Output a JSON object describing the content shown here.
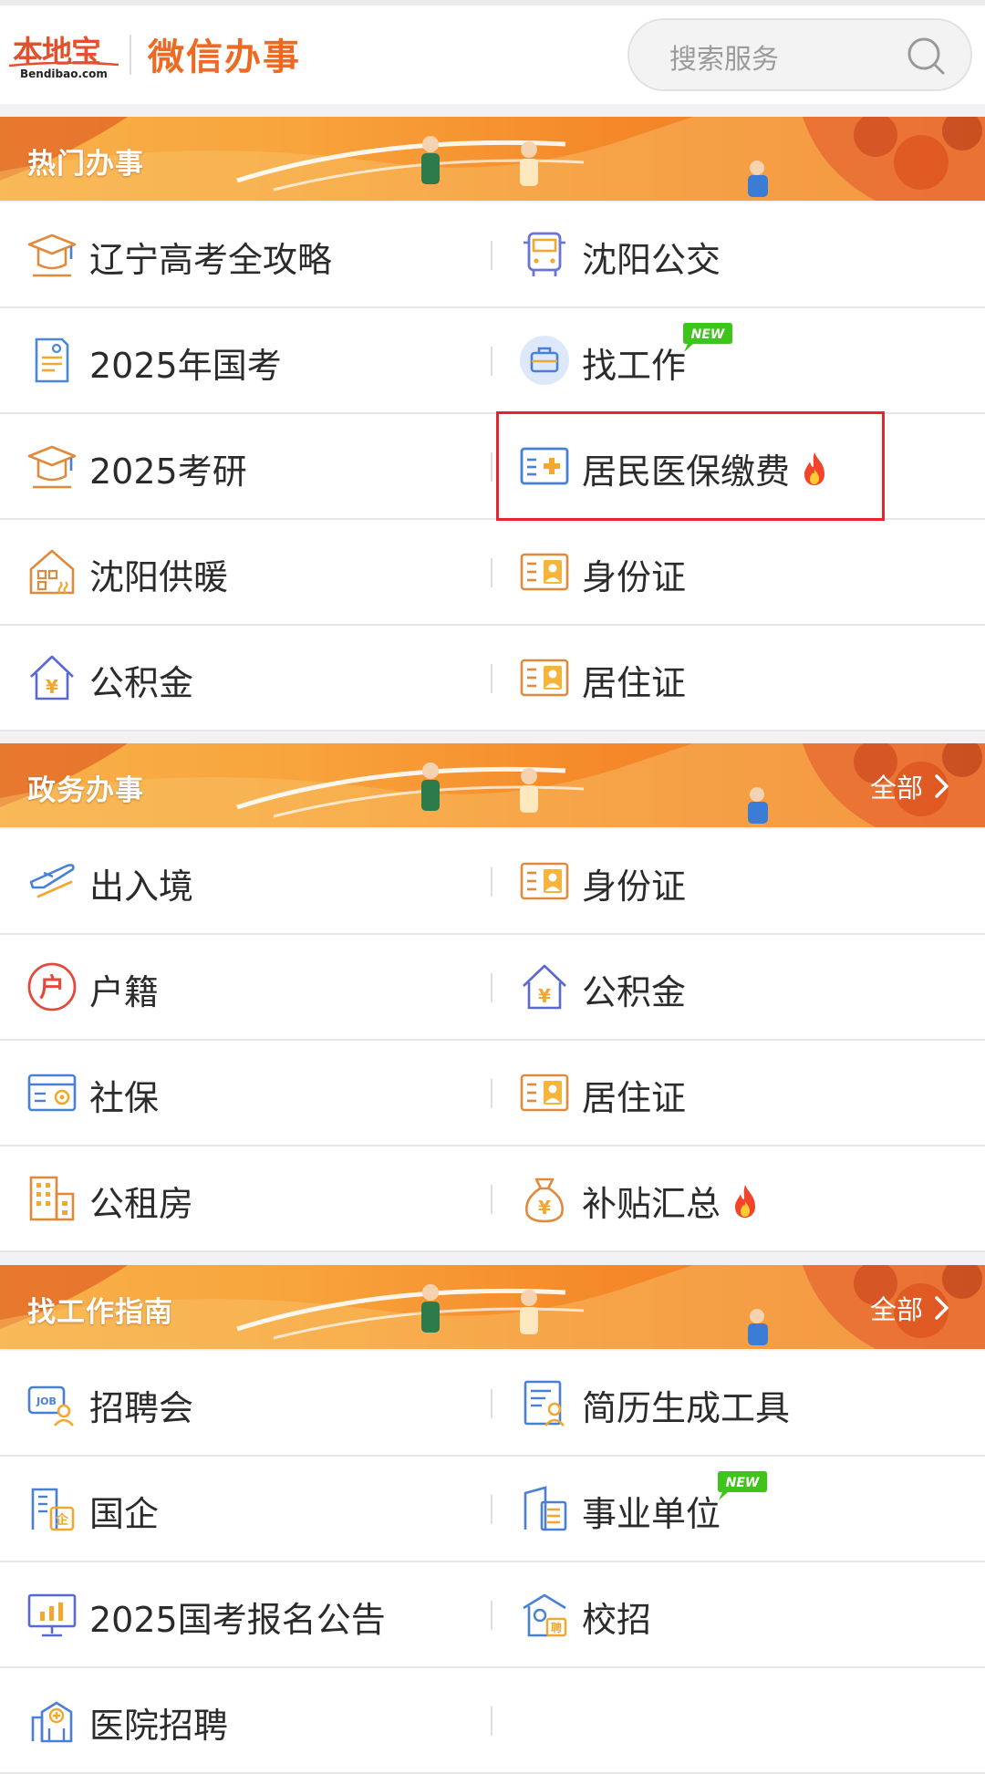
{
  "header": {
    "logo_main": "本地宝",
    "logo_sub": "Bendibao.com",
    "app_title": "微信办事",
    "search_placeholder": "搜索服务"
  },
  "colors": {
    "accent": "#ee6a22",
    "banner_orange": "#f58a2a",
    "highlight_red": "#e5242b",
    "new_badge_green": "#3ec41a",
    "fire_red": "#f2442a"
  },
  "sections": [
    {
      "title": "热门办事",
      "more_label": "",
      "items": [
        {
          "label": "辽宁高考全攻略",
          "icon": "graduation-cap-icon"
        },
        {
          "label": "沈阳公交",
          "icon": "bus-icon"
        },
        {
          "label": "2025年国考",
          "icon": "document-person-icon"
        },
        {
          "label": "找工作",
          "icon": "briefcase-icon",
          "badge": "NEW"
        },
        {
          "label": "2025考研",
          "icon": "graduation-cap-icon"
        },
        {
          "label": "居民医保缴费",
          "icon": "medical-card-icon",
          "hot": true,
          "highlighted": true
        },
        {
          "label": "沈阳供暖",
          "icon": "house-heating-icon"
        },
        {
          "label": "身份证",
          "icon": "id-card-icon"
        },
        {
          "label": "公积金",
          "icon": "house-yuan-icon"
        },
        {
          "label": "居住证",
          "icon": "id-card-icon"
        }
      ]
    },
    {
      "title": "政务办事",
      "more_label": "全部",
      "items": [
        {
          "label": "出入境",
          "icon": "airplane-icon"
        },
        {
          "label": "身份证",
          "icon": "id-card-icon"
        },
        {
          "label": "户籍",
          "icon": "hukou-icon",
          "icon_text": "户"
        },
        {
          "label": "公积金",
          "icon": "house-yuan-icon"
        },
        {
          "label": "社保",
          "icon": "social-security-card-icon"
        },
        {
          "label": "居住证",
          "icon": "id-card-icon"
        },
        {
          "label": "公租房",
          "icon": "building-icon"
        },
        {
          "label": "补贴汇总",
          "icon": "money-bag-icon",
          "hot": true
        }
      ]
    },
    {
      "title": "找工作指南",
      "more_label": "全部",
      "items": [
        {
          "label": "招聘会",
          "icon": "job-board-icon",
          "icon_text": "JOB"
        },
        {
          "label": "简历生成工具",
          "icon": "resume-icon"
        },
        {
          "label": "国企",
          "icon": "state-enterprise-icon",
          "icon_text": "企"
        },
        {
          "label": "事业单位",
          "icon": "institution-icon",
          "badge": "NEW"
        },
        {
          "label": "2025国考报名公告",
          "icon": "monitor-chart-icon"
        },
        {
          "label": "校招",
          "icon": "campus-recruit-icon",
          "icon_text": "聘"
        },
        {
          "label": "医院招聘",
          "icon": "hospital-icon"
        },
        {
          "label": "",
          "icon": ""
        }
      ]
    }
  ]
}
